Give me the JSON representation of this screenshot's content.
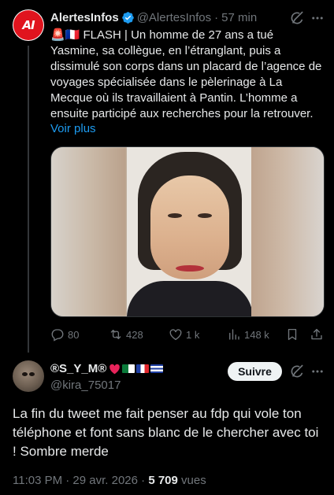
{
  "parent_tweet": {
    "author_name": "AlertesInfos",
    "avatar_text": "AI",
    "handle": "@AlertesInfos",
    "separator": "·",
    "time": "57 min",
    "text": "🚨🇫🇷 FLASH | Un homme de 27 ans a tué Yasmine, sa collègue, en l’étranglant, puis a dissimulé son corps dans un placard de l’agence de voyages spécialisée dans le pèlerinage à La Mecque où ils travaillaient à Pantin. L’homme a ensuite participé aux recherches pour la retrouver.",
    "show_more": "Voir plus",
    "stats": {
      "replies": "80",
      "reposts": "428",
      "likes": "1 k",
      "views": "148 k"
    }
  },
  "reply_tweet": {
    "author_name": "®S_Y_M®",
    "handle": "@kira_75017",
    "follow_label": "Suivre",
    "text": "La fin du tweet me fait penser au fdp qui vole ton téléphone et font sans blanc de le chercher avec toi ! Sombre merde",
    "timestamp": "11:03 PM · 29 avr. 2026 ·",
    "views_count": "5 709",
    "views_label": "vues"
  },
  "colors": {
    "background": "#000000",
    "text": "#e7e9ea",
    "muted": "#71767b",
    "link": "#1d9bf0",
    "verified": "#1d9bf0",
    "follow_bg": "#eff3f4"
  },
  "icons": [
    "verified-badge-icon",
    "grok-icon",
    "more-icon",
    "reply-icon",
    "repost-icon",
    "like-icon",
    "views-icon",
    "bookmark-icon",
    "share-icon"
  ]
}
